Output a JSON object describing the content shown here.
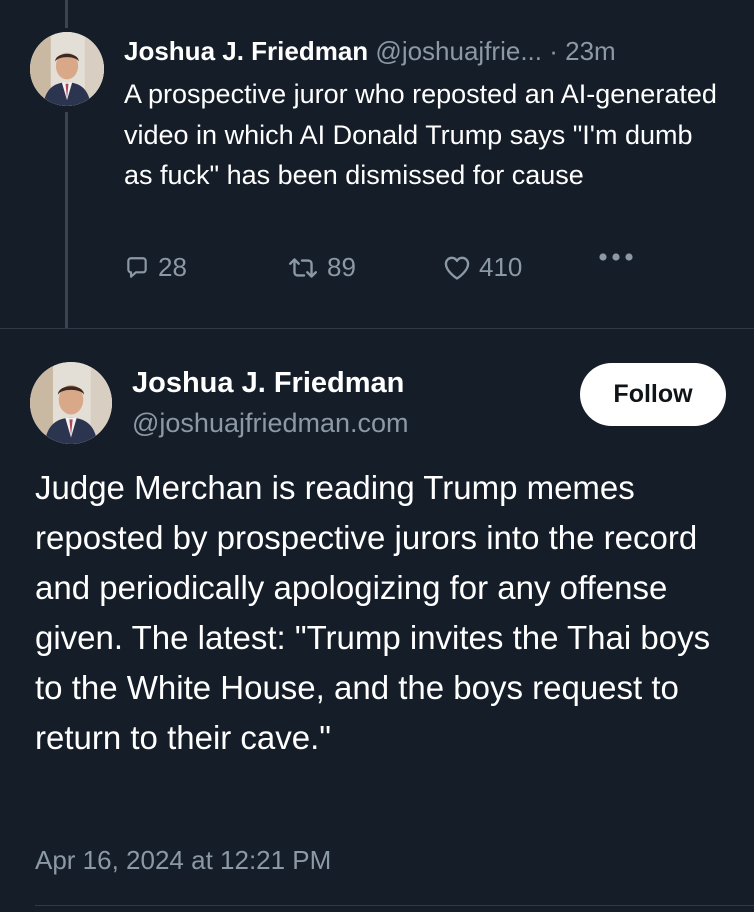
{
  "reply_post": {
    "author_name": "Joshua J. Friedman",
    "handle": "@joshuajfrie...",
    "separator": "·",
    "time": "23m",
    "text": "A prospective juror who reposted an AI-generated video in which AI Donald Trump says \"I'm dumb as fuck\" has been dismissed for cause",
    "actions": {
      "replies": "28",
      "reposts": "89",
      "likes": "410"
    },
    "icons": [
      "reply-icon",
      "repost-icon",
      "heart-icon",
      "more-icon"
    ]
  },
  "main_post": {
    "author_name": "Joshua J. Friedman",
    "handle": "@joshuajfriedman.com",
    "follow_label": "Follow",
    "text": "Judge Merchan is reading Trump memes reposted by prospective jurors into the record and periodically apologizing for any offense given. The latest: \"Trump invites the Thai boys to the White House, and the boys request to return to their cave.\"",
    "timestamp": "Apr 16, 2024 at 12:21 PM"
  },
  "colors": {
    "background": "#151d28",
    "text_primary": "#ffffff",
    "text_muted": "#8b98a5",
    "divider": "#2f3a46",
    "follow_bg": "#ffffff"
  }
}
